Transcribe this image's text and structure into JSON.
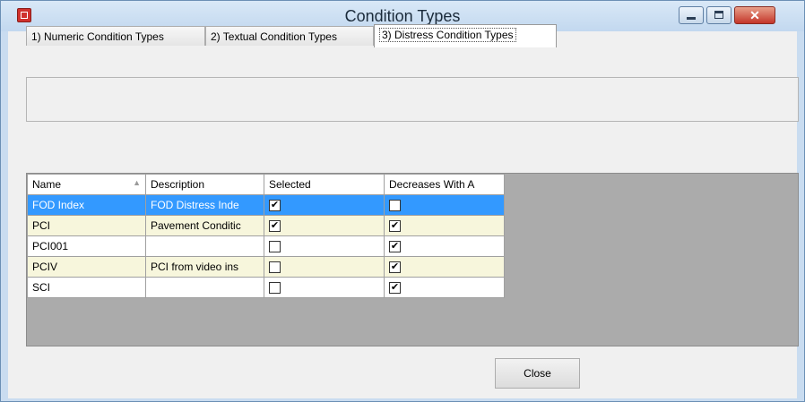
{
  "window": {
    "title": "Condition Types",
    "app_icon": "app-icon",
    "controls": [
      "minimize-icon",
      "maximize-icon",
      "close-icon"
    ],
    "close_glyph": "✕"
  },
  "tabs": [
    {
      "label": "1) Numeric Condition Types",
      "active": false
    },
    {
      "label": "2) Textual Condition Types",
      "active": false
    },
    {
      "label": "3) Distress Condition Types",
      "active": true
    }
  ],
  "grid": {
    "columns": [
      "Name",
      "Description",
      "Selected",
      "Decreases With A"
    ],
    "sort_column": "Name",
    "sort_icon": "▲",
    "rows": [
      {
        "name": "FOD Index",
        "description": "FOD Distress Inde",
        "selected": true,
        "decreases": false,
        "highlighted": true
      },
      {
        "name": "PCI",
        "description": "Pavement Conditic",
        "selected": true,
        "decreases": true,
        "highlighted": false
      },
      {
        "name": "PCI001",
        "description": "",
        "selected": false,
        "decreases": true,
        "highlighted": false
      },
      {
        "name": "PCIV",
        "description": "PCI from video ins",
        "selected": false,
        "decreases": true,
        "highlighted": false
      },
      {
        "name": "SCI",
        "description": "",
        "selected": false,
        "decreases": true,
        "highlighted": false
      }
    ]
  },
  "footer": {
    "close_label": "Close"
  },
  "colors": {
    "selection": "#3399ff",
    "alt_row": "#f7f6dc",
    "grid_background": "#ababab"
  }
}
